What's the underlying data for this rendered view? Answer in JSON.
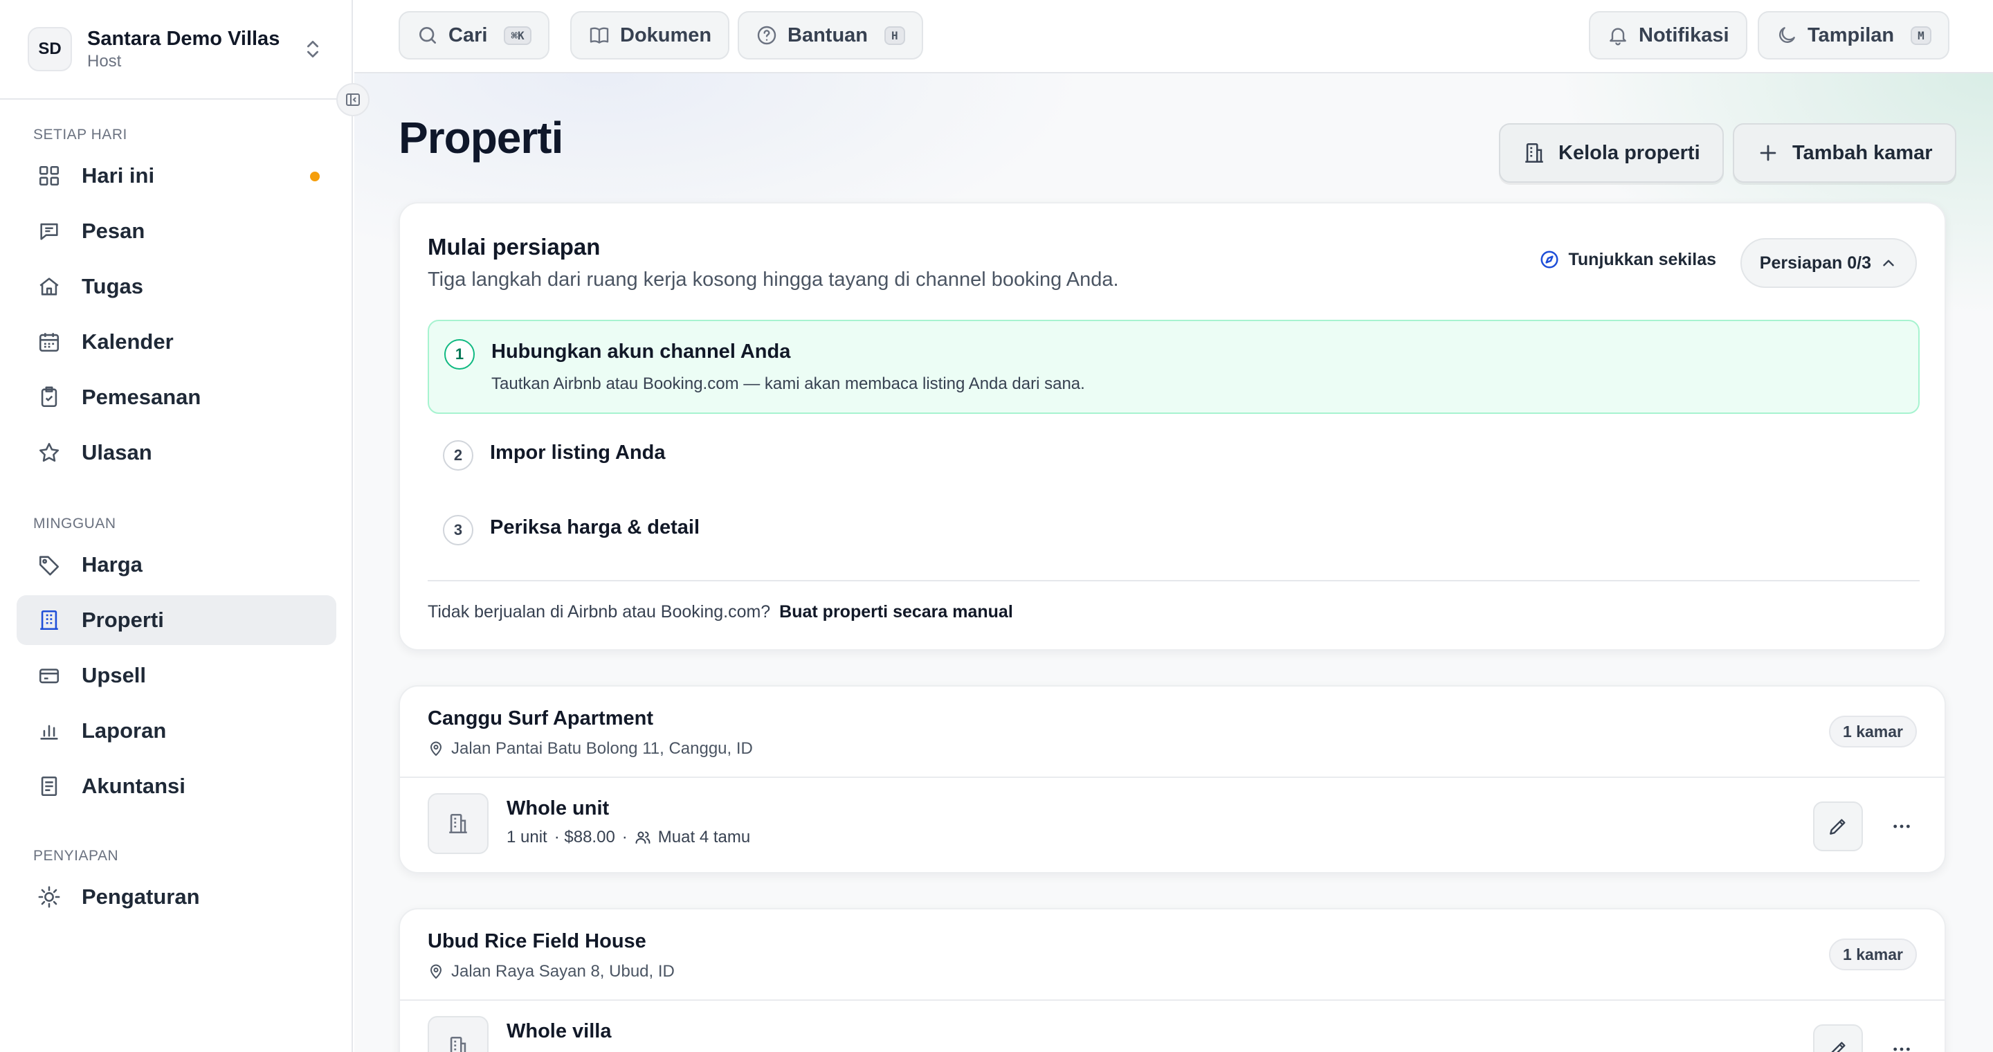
{
  "workspace": {
    "initials": "SD",
    "name": "Santara Demo Villas",
    "role": "Host"
  },
  "sidebar": {
    "sections": [
      {
        "heading": "SETIAP HARI",
        "items": [
          {
            "label": "Hari ini",
            "icon": "grid-icon",
            "dot": true
          },
          {
            "label": "Pesan",
            "icon": "message-icon"
          },
          {
            "label": "Tugas",
            "icon": "home-icon"
          },
          {
            "label": "Kalender",
            "icon": "calendar-icon"
          },
          {
            "label": "Pemesanan",
            "icon": "clipboard-check-icon"
          },
          {
            "label": "Ulasan",
            "icon": "star-icon"
          }
        ]
      },
      {
        "heading": "MINGGUAN",
        "items": [
          {
            "label": "Harga",
            "icon": "tag-icon"
          },
          {
            "label": "Properti",
            "icon": "building-icon",
            "active": true
          },
          {
            "label": "Upsell",
            "icon": "card-icon"
          },
          {
            "label": "Laporan",
            "icon": "bar-chart-icon"
          },
          {
            "label": "Akuntansi",
            "icon": "ledger-icon"
          }
        ]
      },
      {
        "heading": "PENYIAPAN",
        "items": [
          {
            "label": "Pengaturan",
            "icon": "sun-gear-icon"
          }
        ]
      }
    ]
  },
  "topbar": {
    "search": {
      "label": "Cari",
      "shortcut": "⌘K"
    },
    "docs": {
      "label": "Dokumen"
    },
    "help": {
      "label": "Bantuan",
      "shortcut": "H"
    },
    "notifications": {
      "label": "Notifikasi"
    },
    "appearance": {
      "label": "Tampilan",
      "shortcut": "M"
    }
  },
  "page": {
    "title": "Properti",
    "manage_label": "Kelola properti",
    "add_room_label": "Tambah kamar"
  },
  "setup": {
    "title": "Mulai persiapan",
    "subtitle": "Tiga langkah dari ruang kerja kosong hingga tayang di channel booking Anda.",
    "glance_label": "Tunjukkan sekilas",
    "progress_label": "Persiapan 0/3",
    "progress": {
      "done": 0,
      "total": 3
    },
    "steps": [
      {
        "num": "1",
        "title": "Hubungkan akun channel Anda",
        "desc": "Tautkan Airbnb atau Booking.com — kami akan membaca listing Anda dari sana."
      },
      {
        "num": "2",
        "title": "Impor listing Anda"
      },
      {
        "num": "3",
        "title": "Periksa harga & detail"
      }
    ],
    "manual_text": "Tidak berjualan di Airbnb atau Booking.com?",
    "manual_link": "Buat properti secara manual"
  },
  "properties": [
    {
      "name": "Canggu Surf Apartment",
      "address": "Jalan Pantai Batu Bolong 11, Canggu, ID",
      "badge": "1 kamar",
      "room": {
        "name": "Whole unit",
        "units": "1 unit",
        "price": "· $88.00",
        "guests": "Muat 4 tamu"
      }
    },
    {
      "name": "Ubud Rice Field House",
      "address": "Jalan Raya Sayan 8, Ubud, ID",
      "badge": "1 kamar",
      "room": {
        "name": "Whole villa"
      }
    }
  ],
  "colors": {
    "accent": "#1d4ed8",
    "step_active_bg": "#ecfdf5",
    "step_active_border": "#a7f3d0",
    "notification_dot": "#f59e0b"
  }
}
